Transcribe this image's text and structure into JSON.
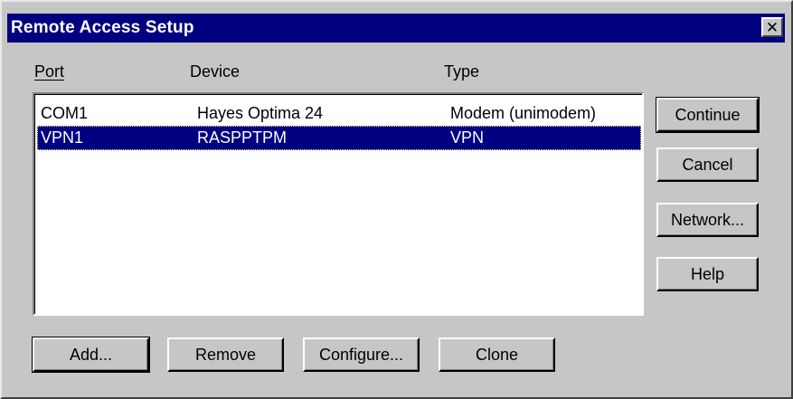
{
  "window": {
    "title": "Remote Access Setup",
    "close_glyph": "✕"
  },
  "columns": {
    "port": "Port",
    "device": "Device",
    "type": "Type"
  },
  "rows": [
    {
      "port": "COM1",
      "device": "Hayes Optima 24",
      "type": "Modem (unimodem)",
      "selected": false
    },
    {
      "port": "VPN1",
      "device": "RASPPTPM",
      "type": "VPN",
      "selected": true
    }
  ],
  "side_buttons": {
    "continue": "Continue",
    "cancel": "Cancel",
    "network": "Network...",
    "help": "Help"
  },
  "bottom_buttons": {
    "add": "Add...",
    "remove": "Remove",
    "configure": "Configure...",
    "clone": "Clone"
  },
  "colors": {
    "face": "#c6c6c6",
    "titlebar": "#000080",
    "selection": "#000080"
  }
}
